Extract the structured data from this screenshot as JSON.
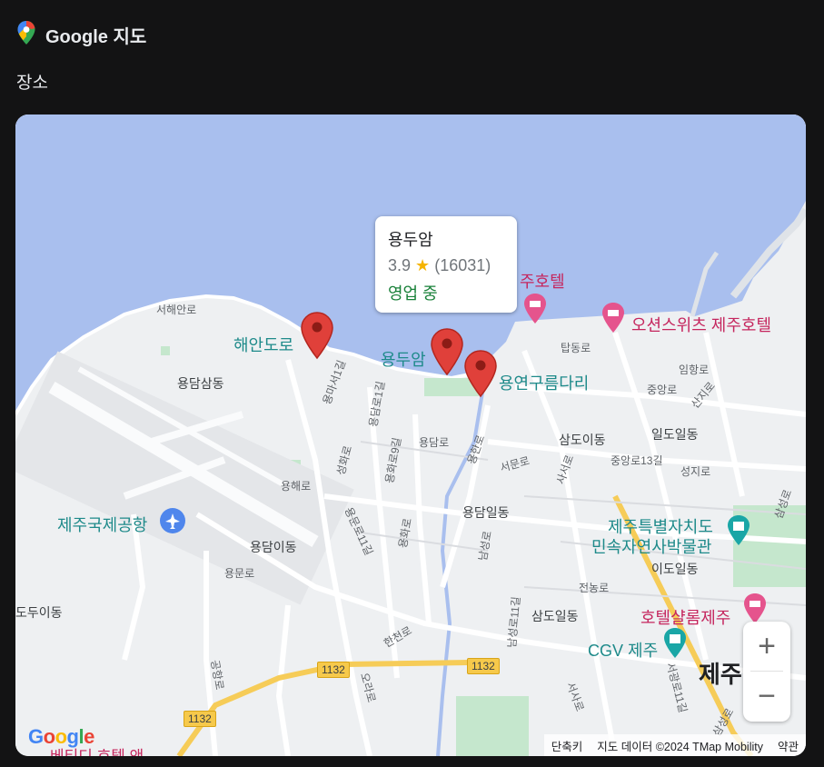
{
  "app": {
    "title": "Google 지도",
    "section": "장소"
  },
  "infocard": {
    "name": "용두암",
    "rating": "3.9",
    "star": "★",
    "reviews": "(16031)",
    "status": "영업 중"
  },
  "places": {
    "haean": "해안도로",
    "yongduam": "용두암",
    "yongyeon": "용연구름다리",
    "airport": "제주국제공항",
    "ocean_suites": "오션스위츠 제주호텔",
    "ju_hotel": "주호텔",
    "museum_line1": "제주특별자치도",
    "museum_line2": "민속자연사박물관",
    "hotel_salrom": "호텔샬롬제주",
    "cgv": "CGV 제주",
    "jeju_city": "제주",
    "bottom_hotel": "베티디 호텔 앤"
  },
  "districts": [
    "용담삼동",
    "용담이동",
    "용담일동",
    "삼도이동",
    "일도일동",
    "이도일동",
    "삼도일동",
    "도두이동"
  ],
  "streets": [
    "서해안로",
    "용마서1길",
    "용담로1길",
    "용담로",
    "성화로",
    "용화로9길",
    "용해로",
    "용문로11길",
    "용문로",
    "용화로",
    "용한로",
    "서문로",
    "사서로",
    "탑동로",
    "중앙로",
    "임항로",
    "산지로",
    "중앙로13길",
    "성지로",
    "전농로",
    "남성로",
    "남성로11길",
    "한천로",
    "삼성로",
    "공항로",
    "오라로",
    "서광로11길",
    "서사로",
    "삼성로"
  ],
  "routes": [
    "1132",
    "1132",
    "1132"
  ],
  "zoom": {
    "in": "+",
    "out": "−"
  },
  "footer": {
    "shortcuts": "단축키",
    "data": "지도 데이터 ©2024 TMap Mobility",
    "terms": "약관"
  },
  "logo": "Google",
  "colors": {
    "water": "#a9bfee",
    "land": "#eef0f2",
    "park": "#c5e7cd",
    "road_yellow": "#f6cc58",
    "pin": "#ea4335",
    "teal": "#1e8a8a",
    "pink": "#c5265e"
  }
}
